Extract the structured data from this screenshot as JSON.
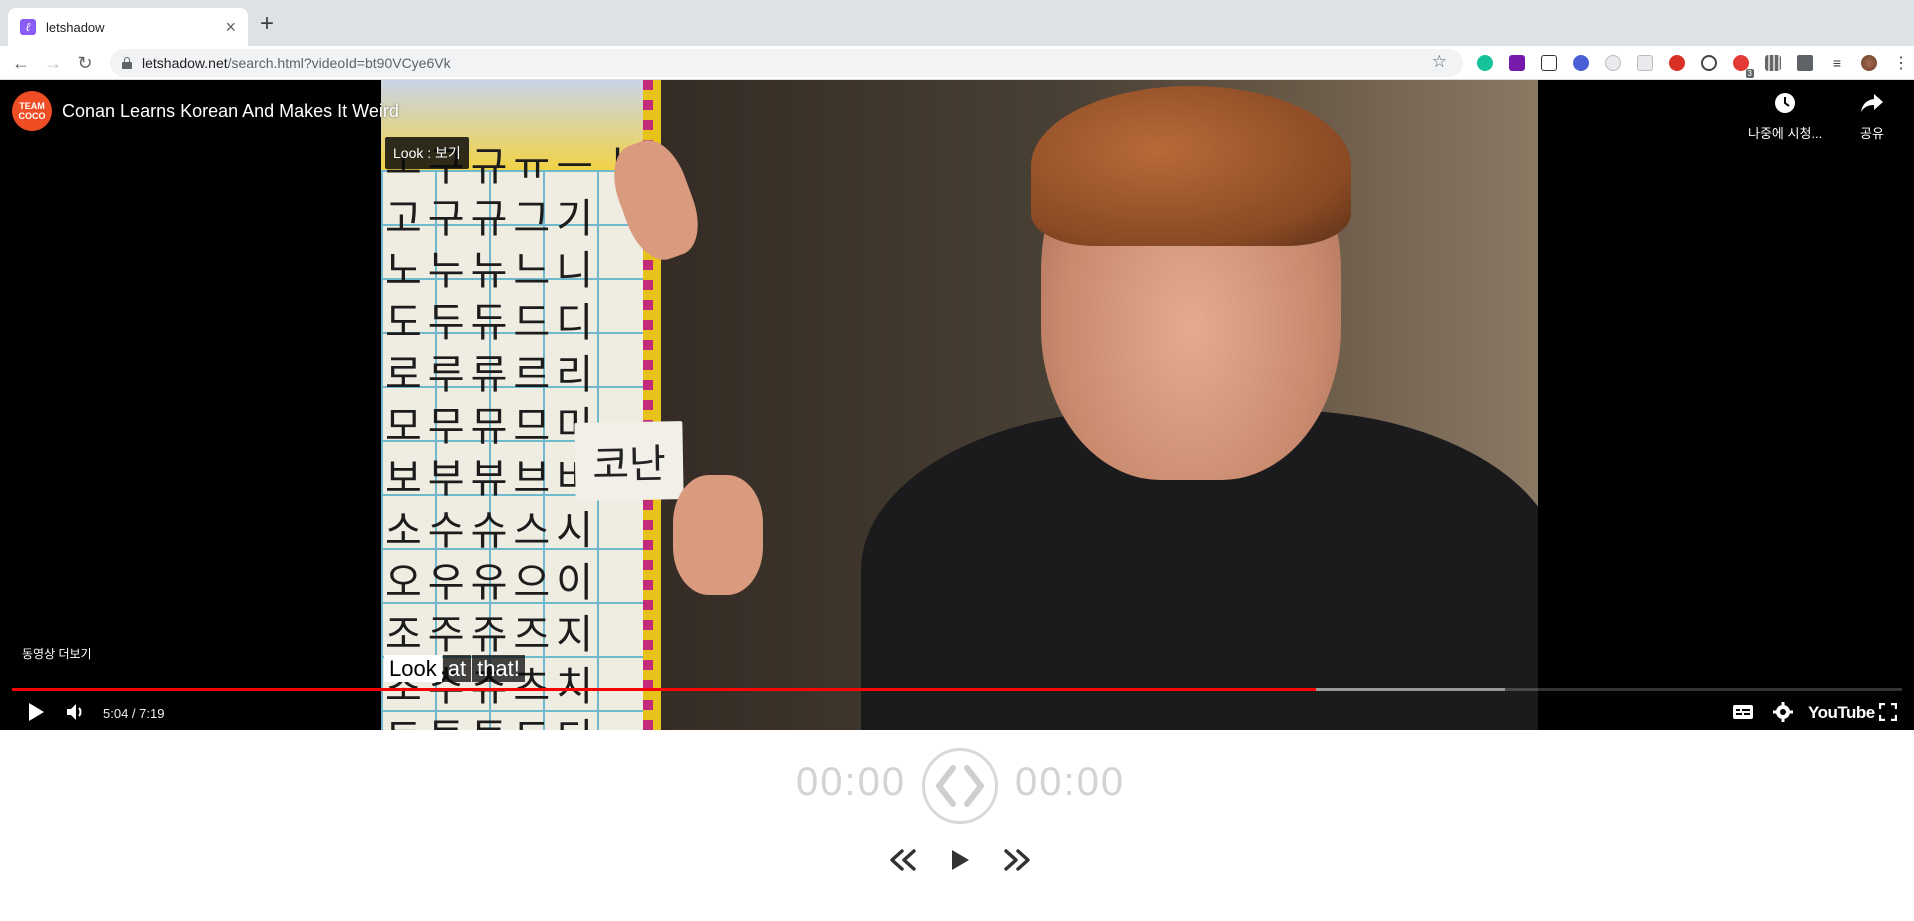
{
  "browser": {
    "tab_title": "letshadow",
    "tab_favicon": "ℓ",
    "url_host": "letshadow.net",
    "url_path": "/search.html?videoId=bt90VCye6Vk",
    "extension_badge": "3"
  },
  "player": {
    "channel_avatar_text": "TEAM COCO",
    "video_title": "Conan Learns Korean And Makes It Weird",
    "watch_later_label": "나중에 시청...",
    "share_label": "공유",
    "hint_text": "Look : 보기",
    "more_videos_label": "동영상 더보기",
    "name_card_text": "코난",
    "caption_words": [
      "Look",
      "at",
      "that!"
    ],
    "caption_highlight_index": 0,
    "current_time": "5:04",
    "duration": "7:19",
    "progress_fraction": 0.69,
    "buffered_fraction": 0.79,
    "youtube_logo": "YouTube",
    "chart_rows": [
      "ㅗ구규ㅠㅡㅣ",
      "고구규그기",
      "노누뉴느니",
      "도두듀드디",
      "로루류르리",
      "모무뮤므미",
      "보부뷰브비",
      "소수슈스시",
      "오우유으이",
      "조주쥬즈지",
      "초추츄츠치",
      "토투튜트티"
    ]
  },
  "shadow": {
    "start_time": "00:00",
    "end_time": "00:00"
  },
  "colors": {
    "progress_played": "#ff0000",
    "avatar": "#ef4d23",
    "favicon": "#8a5cf6"
  }
}
